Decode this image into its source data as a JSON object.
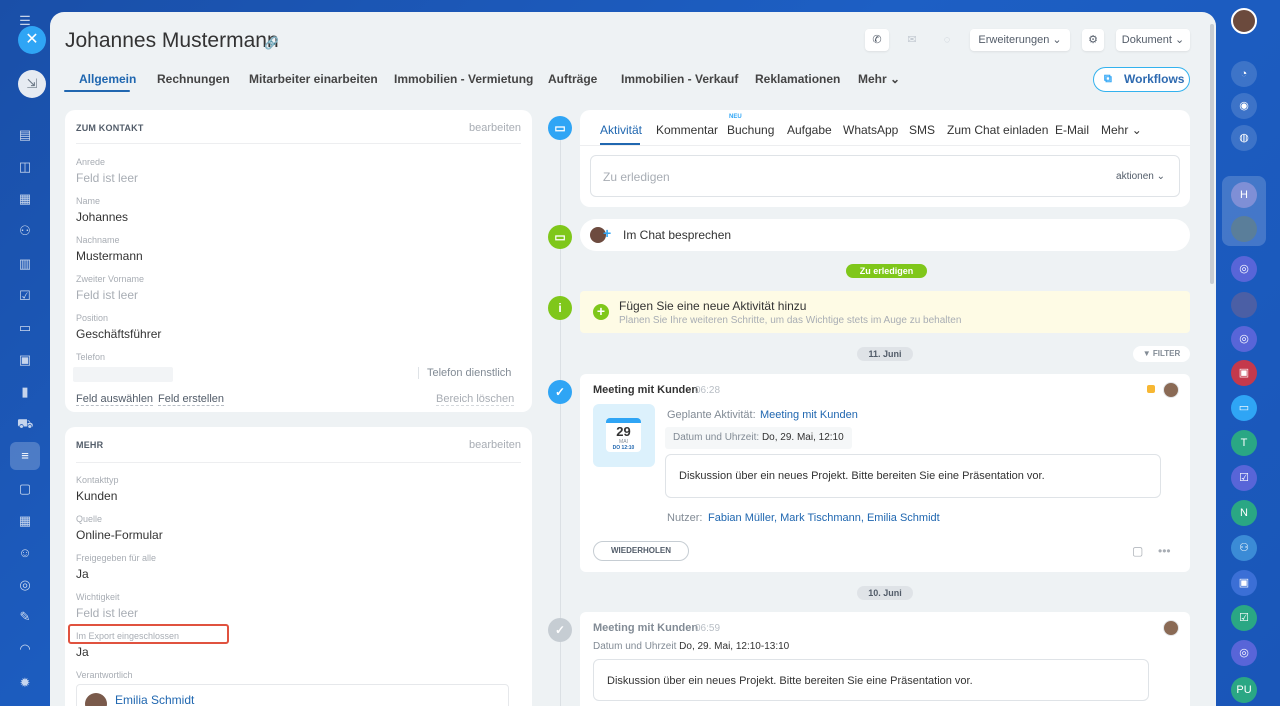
{
  "left_rail": {
    "close_icon": "close-icon",
    "minimize_icon": "minimize-icon",
    "icons": [
      "menu-icon",
      "home-icon",
      "document-icon",
      "chat-icon",
      "calendar-icon",
      "contacts-icon",
      "file-icon",
      "tasks-icon",
      "card-icon",
      "presentation-icon",
      "chart-icon",
      "cart-icon",
      "filter-icon",
      "inbox-icon",
      "schedule-icon",
      "robot-icon",
      "target-icon",
      "sign-icon",
      "headset-icon",
      "settings-icon"
    ]
  },
  "header": {
    "title": "Johannes Mustermann",
    "erweiterungen_label": "Erweiterungen",
    "dokument_label": "Dokument",
    "workflows_label": "Workflows"
  },
  "nav": {
    "tabs": [
      {
        "label": "Allgemein"
      },
      {
        "label": "Rechnungen"
      },
      {
        "label": "Mitarbeiter einarbeiten"
      },
      {
        "label": "Immobilien - Vermietung"
      },
      {
        "label": "Aufträge"
      },
      {
        "label": "Immobilien - Verkauf"
      },
      {
        "label": "Reklamationen"
      },
      {
        "label": "Mehr"
      }
    ]
  },
  "contact_card": {
    "heading": "ZUM KONTAKT",
    "edit_label": "bearbeiten",
    "fields": [
      {
        "label": "Anrede",
        "value": "Feld ist leer"
      },
      {
        "label": "Name",
        "value": "Johannes"
      },
      {
        "label": "Nachname",
        "value": "Mustermann"
      },
      {
        "label": "Zweiter Vorname",
        "value": "Feld ist leer"
      },
      {
        "label": "Position",
        "value": "Geschäftsführer"
      },
      {
        "label": "Telefon",
        "value": ""
      }
    ],
    "phone_type": "Telefon dienstlich",
    "select_field": "Feld auswählen",
    "create_field": "Feld erstellen",
    "delete_section": "Bereich löschen"
  },
  "more_card": {
    "heading": "MEHR",
    "edit_label": "bearbeiten",
    "fields": [
      {
        "label": "Kontakttyp",
        "value": "Kunden"
      },
      {
        "label": "Quelle",
        "value": "Online-Formular"
      },
      {
        "label": "Freigegeben für alle",
        "value": "Ja"
      },
      {
        "label": "Wichtigkeit",
        "value": "Feld ist leer"
      },
      {
        "label": "Im Export eingeschlossen",
        "value": "Ja"
      },
      {
        "label": "Verantwortlich",
        "value": "Emilia Schmidt"
      }
    ]
  },
  "editor": {
    "tabs": [
      "Aktivität",
      "Kommentar",
      "Buchung",
      "Aufgabe",
      "WhatsApp",
      "SMS",
      "Zum Chat einladen",
      "E-Mail",
      "Mehr"
    ],
    "neu_badge": "NEU",
    "placeholder": "Zu erledigen",
    "actions_label": "aktionen"
  },
  "timeline": {
    "chat_label": "Im Chat besprechen",
    "todo_pill": "Zu erledigen",
    "add_title": "Fügen Sie eine neue Aktivität hinzu",
    "add_sub": "Planen Sie Ihre weiteren Schritte, um das Wichtige stets im Auge zu behalten",
    "date1": "11. Juni",
    "filter_label": "FILTER",
    "meeting1": {
      "title": "Meeting mit Kunden",
      "time": "06:28",
      "cal_day": "29",
      "cal_month": "MAI",
      "cal_time": "DO 12:10",
      "planned_label": "Geplante Aktivität:",
      "planned_value": "Meeting mit Kunden",
      "date_label": "Datum und Uhrzeit:",
      "date_value": "Do, 29. Mai, 12:10",
      "description": "Diskussion über ein neues Projekt. Bitte bereiten Sie eine Präsentation vor.",
      "users_label": "Nutzer:",
      "users_value": "Fabian Müller, Mark Tischmann, Emilia Schmidt",
      "repeat_label": "WIEDERHOLEN"
    },
    "date2": "10. Juni",
    "meeting2": {
      "title": "Meeting mit Kunden",
      "time": "06:59",
      "date_label": "Datum und Uhrzeit",
      "date_value": "Do, 29. Mai, 12:10-13:10",
      "description": "Diskussion über ein neues Projekt. Bitte bereiten Sie eine Präsentation vor."
    }
  },
  "right_rail": {
    "items": [
      "avatar",
      "bell-icon",
      "activity-icon",
      "search-icon",
      "H",
      "avatar",
      "spiral-icon",
      "avatar",
      "spiral-icon",
      "lock-icon",
      "chat-icon",
      "T",
      "task-icon",
      "N",
      "group-icon",
      "lock-icon",
      "task-icon",
      "spiral-icon",
      "PU"
    ]
  }
}
